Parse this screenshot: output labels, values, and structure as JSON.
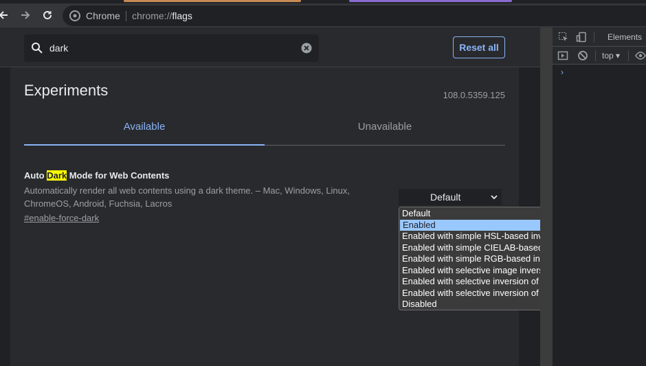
{
  "browser": {
    "omnibox_label": "Chrome",
    "url_scheme": "chrome://",
    "url_host": "flags"
  },
  "search": {
    "value": "dark",
    "reset_label": "Reset all"
  },
  "page": {
    "title": "Experiments",
    "version": "108.0.5359.125",
    "tabs": [
      {
        "label": "Available",
        "active": true
      },
      {
        "label": "Unavailable",
        "active": false
      }
    ]
  },
  "flag": {
    "title_before": "Auto ",
    "title_highlight": "Dark",
    "title_after": " Mode for Web Contents",
    "description": "Automatically render all web contents using a dark theme. – Mac, Windows, Linux, ChromeOS, Android, Fuchsia, Lacros",
    "link": "#enable-force-dark",
    "selected_value": "Default"
  },
  "dropdown": {
    "options": [
      "Default",
      "Enabled",
      "Enabled with simple HSL-based inversion",
      "Enabled with simple CIELAB-based inversion",
      "Enabled with simple RGB-based inversion",
      "Enabled with selective image inversion",
      "Enabled with selective inversion of non-image elements",
      "Enabled with selective inversion of everything",
      "Disabled"
    ],
    "highlighted_index": 1
  },
  "devtools": {
    "tab_label": "Elements",
    "context_label": "top",
    "prompt": "›"
  },
  "colors": {
    "accent": "#8ab4f8",
    "highlight": "#ffff00",
    "option_highlight": "#99c8ff"
  }
}
